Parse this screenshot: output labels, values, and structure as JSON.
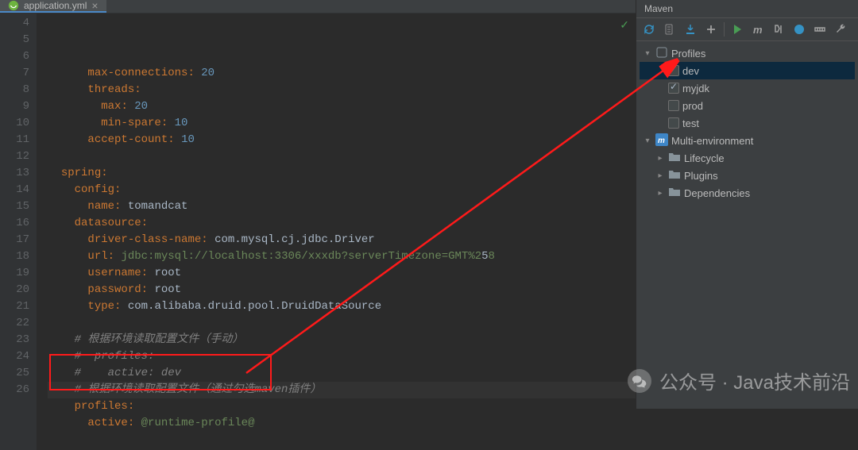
{
  "editor": {
    "tab_filename": "application.yml",
    "gutter_start": 4,
    "gutter_end": 26,
    "highlight_line_no": 23,
    "inspections_icon": "✓",
    "code_lines": [
      {
        "indent": 6,
        "tokens": [
          [
            "key",
            "max-connections"
          ],
          [
            "sep",
            ": "
          ],
          [
            "num",
            "20"
          ]
        ]
      },
      {
        "indent": 6,
        "tokens": [
          [
            "key",
            "threads"
          ],
          [
            "sep",
            ":"
          ]
        ]
      },
      {
        "indent": 8,
        "tokens": [
          [
            "key",
            "max"
          ],
          [
            "sep",
            ": "
          ],
          [
            "num",
            "20"
          ]
        ]
      },
      {
        "indent": 8,
        "tokens": [
          [
            "key",
            "min-spare"
          ],
          [
            "sep",
            ": "
          ],
          [
            "num",
            "10"
          ]
        ]
      },
      {
        "indent": 6,
        "tokens": [
          [
            "key",
            "accept-count"
          ],
          [
            "sep",
            ": "
          ],
          [
            "num",
            "10"
          ]
        ]
      },
      {
        "indent": 0,
        "tokens": []
      },
      {
        "indent": 2,
        "tokens": [
          [
            "key",
            "spring"
          ],
          [
            "sep",
            ":"
          ]
        ]
      },
      {
        "indent": 4,
        "tokens": [
          [
            "key",
            "config"
          ],
          [
            "sep",
            ":"
          ]
        ]
      },
      {
        "indent": 6,
        "tokens": [
          [
            "key",
            "name"
          ],
          [
            "sep",
            ": "
          ],
          [
            "ident",
            "tomandcat"
          ]
        ]
      },
      {
        "indent": 4,
        "tokens": [
          [
            "key",
            "datasource"
          ],
          [
            "sep",
            ":"
          ]
        ]
      },
      {
        "indent": 6,
        "tokens": [
          [
            "key",
            "driver-class-name"
          ],
          [
            "sep",
            ": "
          ],
          [
            "ident",
            "com.mysql.cj.jdbc.Driver"
          ]
        ]
      },
      {
        "indent": 6,
        "tokens": [
          [
            "key",
            "url"
          ],
          [
            "sep",
            ": "
          ],
          [
            "str",
            "jdbc:mysql://localhost:3306/xxxdb?serverTimezone=GMT%2"
          ],
          [
            "ident",
            "5"
          ],
          [
            "str",
            "8"
          ]
        ]
      },
      {
        "indent": 6,
        "tokens": [
          [
            "key",
            "username"
          ],
          [
            "sep",
            ": "
          ],
          [
            "ident",
            "root"
          ]
        ]
      },
      {
        "indent": 6,
        "tokens": [
          [
            "key",
            "password"
          ],
          [
            "sep",
            ": "
          ],
          [
            "ident",
            "root"
          ]
        ]
      },
      {
        "indent": 6,
        "tokens": [
          [
            "key",
            "type"
          ],
          [
            "sep",
            ": "
          ],
          [
            "ident",
            "com.alibaba.druid.pool.DruidDataSource"
          ]
        ]
      },
      {
        "indent": 0,
        "tokens": []
      },
      {
        "indent": 4,
        "tokens": [
          [
            "comm",
            "# 根据环境读取配置文件（手动）"
          ]
        ]
      },
      {
        "indent": 4,
        "tokens": [
          [
            "comm",
            "#  profiles:"
          ]
        ]
      },
      {
        "indent": 4,
        "tokens": [
          [
            "comm",
            "#    active: dev"
          ]
        ]
      },
      {
        "indent": 4,
        "tokens": [
          [
            "comm",
            "# 根据环境读取配置文件（通过勾选maven插件）"
          ]
        ]
      },
      {
        "indent": 4,
        "tokens": [
          [
            "key",
            "profiles"
          ],
          [
            "sep",
            ":"
          ]
        ]
      },
      {
        "indent": 6,
        "tokens": [
          [
            "key",
            "active"
          ],
          [
            "sep",
            ": "
          ],
          [
            "str",
            "@runtime-profile@"
          ]
        ]
      },
      {
        "indent": 0,
        "tokens": []
      }
    ],
    "highlight_box": {
      "lines": [
        24,
        25
      ]
    }
  },
  "maven": {
    "title": "Maven",
    "toolbar_icons": [
      "reload",
      "generate",
      "download",
      "add",
      "separator",
      "run",
      "m",
      "skip",
      "online",
      "offline",
      "wrench"
    ],
    "tree": {
      "profiles_label": "Profiles",
      "profiles_expanded": true,
      "profiles": [
        {
          "name": "dev",
          "checked": true,
          "selected": true
        },
        {
          "name": "myjdk",
          "checked": true,
          "selected": false
        },
        {
          "name": "prod",
          "checked": false,
          "selected": false
        },
        {
          "name": "test",
          "checked": false,
          "selected": false
        }
      ],
      "project_label": "Multi-environment",
      "project_expanded": true,
      "project_children": [
        {
          "name": "Lifecycle",
          "icon": "folder"
        },
        {
          "name": "Plugins",
          "icon": "folder"
        },
        {
          "name": "Dependencies",
          "icon": "folder"
        }
      ]
    }
  },
  "watermark": {
    "text": "公众号 · Java技术前沿"
  }
}
